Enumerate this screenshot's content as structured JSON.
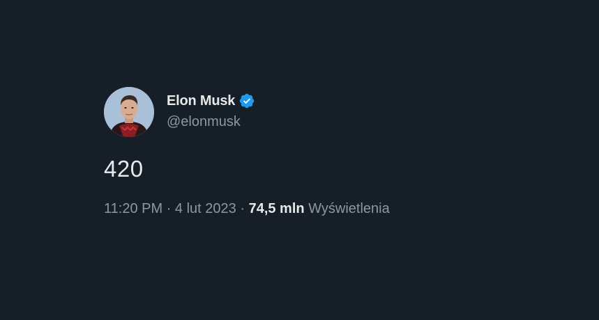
{
  "author": {
    "display_name": "Elon Musk",
    "handle": "@elonmusk",
    "verified": true,
    "verified_color": "#1d9bf0"
  },
  "tweet": {
    "text": "420"
  },
  "meta": {
    "time": "11:20 PM",
    "separator": "·",
    "date": "4 lut 2023",
    "views_count": "74,5 mln",
    "views_label": "Wyświetlenia"
  },
  "colors": {
    "background": "#161e27",
    "primary_text": "#e7e9ea",
    "secondary_text": "#8b98a5"
  }
}
